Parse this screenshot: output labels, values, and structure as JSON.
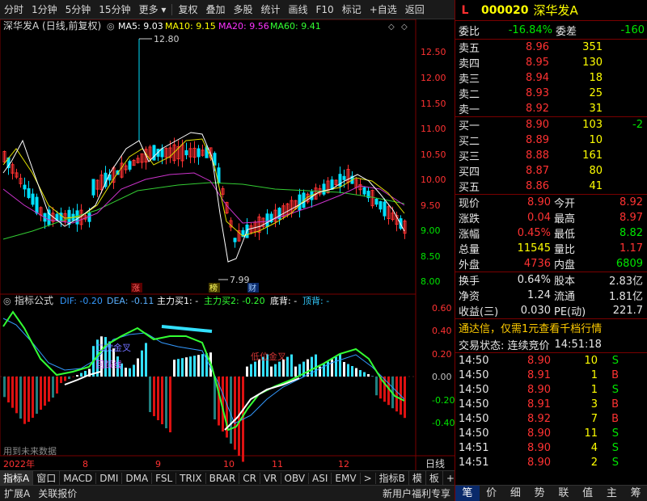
{
  "toolbar": {
    "items": [
      "分时",
      "1分钟",
      "5分钟",
      "15分钟",
      "更多",
      "复权",
      "叠加",
      "多股",
      "统计",
      "画线",
      "F10",
      "标记",
      "+自选",
      "返回"
    ]
  },
  "legend": {
    "stock": "深华发A (日线,前复权)",
    "ma5": "MA5: 9.03",
    "ma10": "MA10: 9.15",
    "ma20": "MA20: 9.56",
    "ma60": "MA60: 9.41"
  },
  "main_axis": {
    "ticks": [
      "12.50",
      "12.00",
      "11.50",
      "11.00",
      "10.50",
      "10.00",
      "9.50",
      "9.00",
      "8.50",
      "8.00"
    ],
    "high_label": "12.80",
    "low_label": "7.99"
  },
  "tags": {
    "t1": "涨",
    "t2": "榜",
    "t3": "财"
  },
  "indicator": {
    "name": "指标公式",
    "dif": "DIF: -0.20",
    "dea": "DEA: -0.11",
    "buy1": "主力买1: -",
    "buy2": "主力买2: -0.20",
    "bottom_div": "底背: -",
    "top_div": "顶背: -",
    "ticks": [
      "0.60",
      "0.40",
      "0.20",
      "0.00",
      "-0.20",
      "-0.40"
    ],
    "annot1": "二次金叉",
    "annot2": "回踩线",
    "annot3": "低位金叉",
    "future_note": "用到未来数据"
  },
  "x_axis": {
    "labels": [
      "2022年",
      "8",
      "9",
      "10",
      "11",
      "12"
    ],
    "period": "日线"
  },
  "tabs": [
    "指标A",
    "窗口",
    "MACD",
    "DMI",
    "DMA",
    "FSL",
    "TRIX",
    "BRAR",
    "CR",
    "VR",
    "OBV",
    "ASI",
    "EMV",
    ">",
    "指标B",
    "模",
    "板",
    "+",
    "-"
  ],
  "bottom": {
    "left1": "扩展A",
    "left2": "关联报价",
    "promo": "新用户福利专享"
  },
  "quote": {
    "badge": "L",
    "code": "000020",
    "name": "深华发A",
    "weibi_label": "委比",
    "weibi": "-16.84%",
    "weicha_label": "委差",
    "weicha": "-160",
    "asks": [
      {
        "label": "卖五",
        "price": "8.96",
        "vol": "351"
      },
      {
        "label": "卖四",
        "price": "8.95",
        "vol": "130"
      },
      {
        "label": "卖三",
        "price": "8.94",
        "vol": "18"
      },
      {
        "label": "卖二",
        "price": "8.93",
        "vol": "25"
      },
      {
        "label": "卖一",
        "price": "8.92",
        "vol": "31"
      }
    ],
    "bids": [
      {
        "label": "买一",
        "price": "8.90",
        "vol": "103",
        "chg": "-2"
      },
      {
        "label": "买二",
        "price": "8.89",
        "vol": "10",
        "chg": ""
      },
      {
        "label": "买三",
        "price": "8.88",
        "vol": "161",
        "chg": ""
      },
      {
        "label": "买四",
        "price": "8.87",
        "vol": "80",
        "chg": ""
      },
      {
        "label": "买五",
        "price": "8.86",
        "vol": "41",
        "chg": ""
      }
    ],
    "stats": [
      {
        "l1": "现价",
        "v1": "8.90",
        "l2": "今开",
        "v2": "8.92"
      },
      {
        "l1": "涨跌",
        "v1": "0.04",
        "l2": "最高",
        "v2": "8.97"
      },
      {
        "l1": "涨幅",
        "v1": "0.45%",
        "l2": "最低",
        "v2": "8.82"
      },
      {
        "l1": "总量",
        "v1": "11545",
        "l2": "量比",
        "v2": "1.17"
      },
      {
        "l1": "外盘",
        "v1": "4736",
        "l2": "内盘",
        "v2": "6809"
      }
    ],
    "stats2": [
      {
        "l1": "换手",
        "v1": "0.64%",
        "l2": "股本",
        "v2": "2.83亿"
      },
      {
        "l1": "净资",
        "v1": "1.24",
        "l2": "流通",
        "v2": "1.81亿"
      },
      {
        "l1": "收益(三)",
        "v1": "0.030",
        "l2": "PE(动)",
        "v2": "221.7"
      }
    ],
    "promo": "通达信，仅需1元查看千档行情",
    "status_label": "交易状态: 连续竞价",
    "status_time": "14:51:18",
    "ticks": [
      {
        "t": "14:50",
        "p": "8.90",
        "v": "10",
        "s": "S"
      },
      {
        "t": "14:50",
        "p": "8.91",
        "v": "1",
        "s": "B"
      },
      {
        "t": "14:50",
        "p": "8.90",
        "v": "1",
        "s": "S"
      },
      {
        "t": "14:50",
        "p": "8.91",
        "v": "3",
        "s": "B"
      },
      {
        "t": "14:50",
        "p": "8.92",
        "v": "7",
        "s": "B"
      },
      {
        "t": "14:50",
        "p": "8.90",
        "v": "11",
        "s": "S"
      },
      {
        "t": "14:51",
        "p": "8.90",
        "v": "4",
        "s": "S"
      },
      {
        "t": "14:51",
        "p": "8.90",
        "v": "2",
        "s": "S"
      }
    ],
    "tabs": [
      "笔",
      "价",
      "细",
      "势",
      "联",
      "值",
      "主",
      "筹"
    ]
  }
}
